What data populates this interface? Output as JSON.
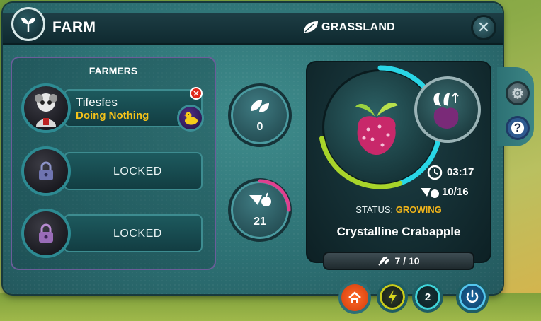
{
  "header": {
    "title": "FARM",
    "region": "GRASSLAND",
    "icons": {
      "farm": "sprout-icon",
      "region": "leaf-icon",
      "close": "close-icon"
    }
  },
  "side_buttons": {
    "settings": "gear-icon",
    "help": "?"
  },
  "farmers": {
    "title": "FARMERS",
    "slots": [
      {
        "name": "Tifesfes",
        "activity": "Doing Nothing",
        "avatar": "farmer-avatar",
        "companion": "duck-icon"
      },
      {
        "label": "LOCKED"
      },
      {
        "label": "LOCKED"
      }
    ]
  },
  "stats": {
    "seeds": "0",
    "harvest": "21",
    "harvest_progress": 0.25
  },
  "crop": {
    "timer": "03:17",
    "yield": "10/16",
    "status_label": "STATUS:",
    "status_value": "GROWING",
    "name": "Crystalline Crabapple",
    "harvests": "7 / 10",
    "growth_progress": 0.72
  },
  "bottom_bar": {
    "workers_count": "2",
    "icons": [
      "home-icon",
      "lightning-icon",
      "power-icon"
    ]
  },
  "colors": {
    "accent_cyan": "#29d6e6",
    "growing": "#f2b51a",
    "activity": "#f5c21a",
    "home": "#ff6a2a"
  }
}
